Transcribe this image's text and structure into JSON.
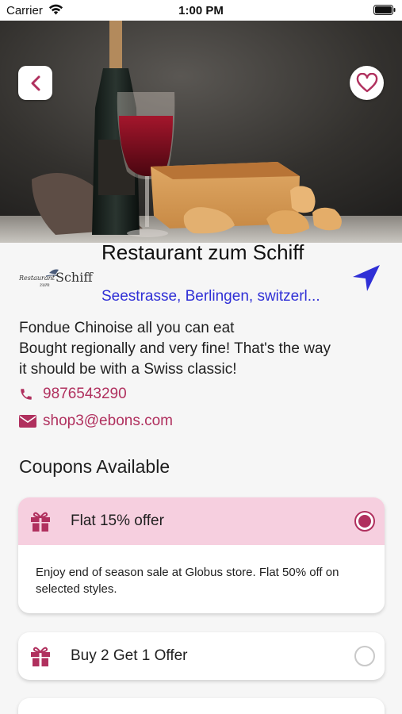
{
  "status_bar": {
    "carrier": "Carrier",
    "time": "1:00 PM"
  },
  "hero": {
    "image_alt": "Wine bottle, glass of red wine and cheese"
  },
  "header": {
    "logo_line1": "Restaurant",
    "logo_line2": "zum",
    "logo_line3": "Schiff",
    "name": "Restaurant zum Schiff",
    "address": "Seestrasse, Berlingen, switzerl..."
  },
  "description": {
    "line1": "Fondue Chinoise all you can eat",
    "line2": "Bought regionally and very fine! That's the way",
    "line3": "it should be with a Swiss classic!"
  },
  "contact": {
    "phone": "9876543290",
    "email": "shop3@ebons.com"
  },
  "coupons": {
    "title": "Coupons Available",
    "items": [
      {
        "title": "Flat 15% offer",
        "selected": true,
        "description": "Enjoy end of season sale at Globus store. Flat 50% off on selected styles."
      },
      {
        "title": "Buy 2 Get 1 Offer",
        "selected": false
      }
    ]
  },
  "colors": {
    "accent": "#b0305e",
    "link_blue": "#2f2fd6",
    "selected_bg": "#f6cfdf",
    "background": "#f6f6f6"
  },
  "icons": [
    "wifi-icon",
    "battery-icon",
    "back-chevron-icon",
    "heart-icon",
    "navigate-arrow-icon",
    "phone-icon",
    "mail-icon",
    "gift-icon"
  ]
}
